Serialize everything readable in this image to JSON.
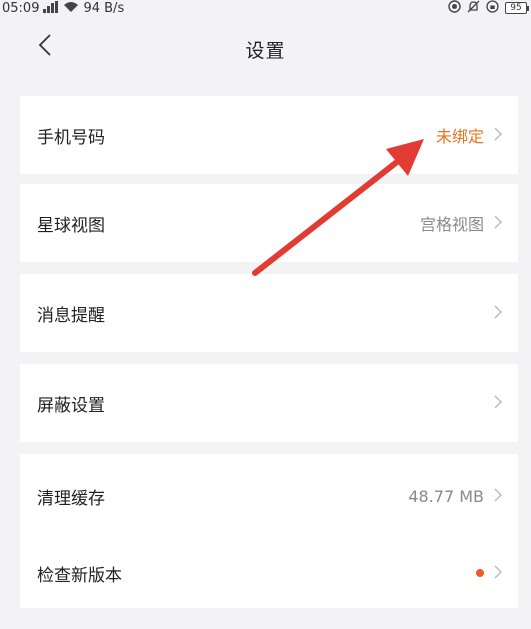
{
  "status_bar": {
    "time": "05:09",
    "signal_icon": "signal-icon",
    "wifi_icon": "wifi-icon",
    "speed": "94 B/s",
    "battery": "95"
  },
  "header": {
    "back_icon": "chevron-left-icon",
    "title": "设置"
  },
  "settings": {
    "phone": {
      "label": "手机号码",
      "value": "未绑定"
    },
    "planet_view": {
      "label": "星球视图",
      "value": "宫格视图"
    },
    "notifications": {
      "label": "消息提醒"
    },
    "block": {
      "label": "屏蔽设置"
    },
    "cache": {
      "label": "清理缓存",
      "value": "48.77 MB"
    },
    "update": {
      "label": "检查新版本"
    }
  },
  "colors": {
    "accent": "#e8731c",
    "update_dot": "#f05a28",
    "annotation_arrow": "#e23b33"
  }
}
